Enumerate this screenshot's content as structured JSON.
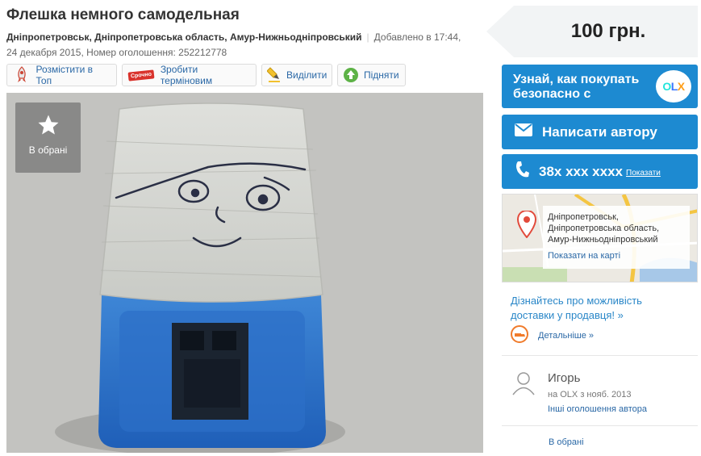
{
  "listing": {
    "title": "Флешка немного самодельная",
    "location": "Дніпропетровськ, Дніпропетровська область, Амур-Нижньодніпровський",
    "added": "Добавлено в 17:44,",
    "date_id": "24 декабря 2015, Номер оголошення: 252212778"
  },
  "promo": {
    "top_label": "Розмістити в Топ",
    "urgent_label": "Зробити терміновим",
    "urgent_badge": "Срочно",
    "highlight_label": "Виділити",
    "raise_label": "Підняти"
  },
  "photo": {
    "favorite_label": "В обрані"
  },
  "sidebar": {
    "price": "100 грн.",
    "how_to_buy_line1": "Узнай, как покупать",
    "how_to_buy_line2": "безопасно с",
    "olx_logo": "OLX",
    "message_label": "Написати автору",
    "phone_number": "38x xxx xxxx",
    "phone_show": "Показати",
    "map": {
      "line1": "Дніпропетровськ,",
      "line2": "Дніпропетровська область,",
      "line3": "Амур-Нижньодніпровський",
      "link": "Показати на карті"
    },
    "delivery": "Дізнайтесь про можливість доставки у продавця! »",
    "details": "Детальніше »",
    "user": {
      "name": "Игорь",
      "since": "на OLX з нояб. 2013",
      "other_ads": "Інші оголошення автора"
    },
    "favorite_link": "В обрані"
  },
  "colors": {
    "accent_blue": "#1d8ad1",
    "link_blue": "#2a68a6"
  }
}
